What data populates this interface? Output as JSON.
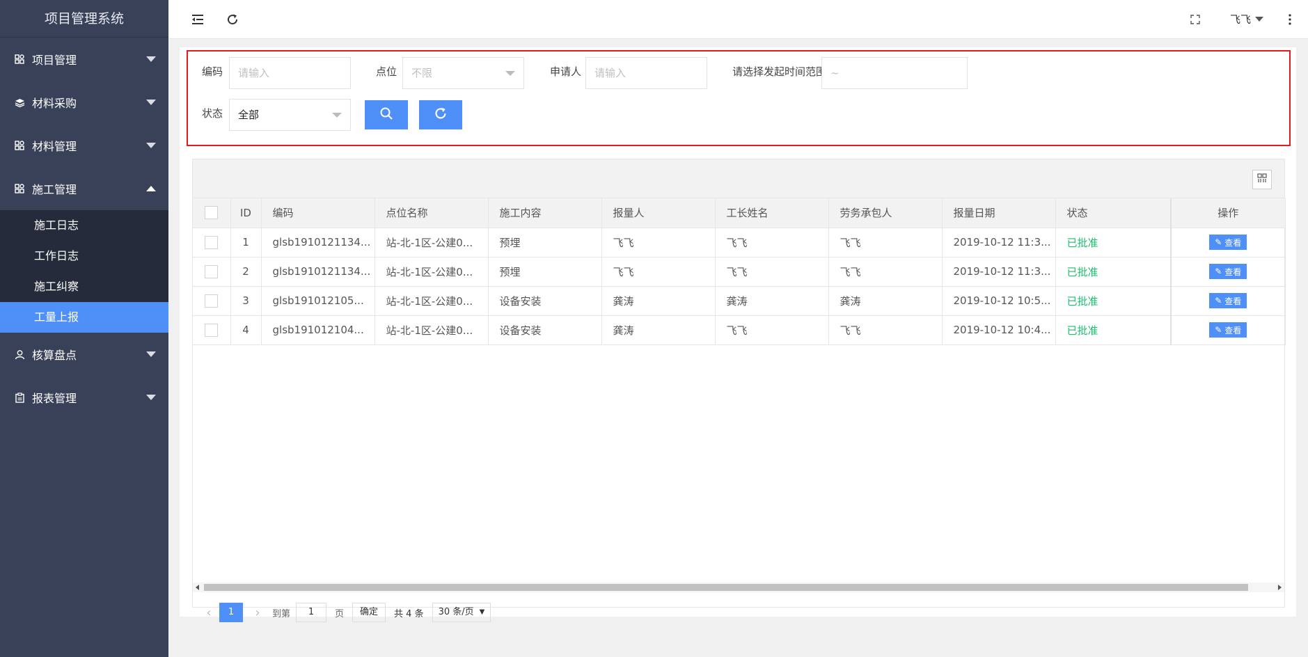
{
  "app": {
    "title": "项目管理系统"
  },
  "sidebar": {
    "items": [
      {
        "label": "项目管理",
        "icon": "grid-icon"
      },
      {
        "label": "材料采购",
        "icon": "layers-icon"
      },
      {
        "label": "材料管理",
        "icon": "grid-icon"
      },
      {
        "label": "施工管理",
        "icon": "grid-icon"
      },
      {
        "label": "核算盘点",
        "icon": "user-icon"
      },
      {
        "label": "报表管理",
        "icon": "clipboard-icon"
      }
    ],
    "sub_items": [
      {
        "label": "施工日志"
      },
      {
        "label": "工作日志"
      },
      {
        "label": "施工纠察"
      },
      {
        "label": "工量上报"
      }
    ]
  },
  "header": {
    "user": "飞飞"
  },
  "filter": {
    "code_label": "编码",
    "code_placeholder": "请输入",
    "point_label": "点位",
    "point_value": "不限",
    "applicant_label": "申请人",
    "applicant_placeholder": "请输入",
    "time_label": "请选择发起时间范围",
    "time_value": "~",
    "status_label": "状态",
    "status_value": "全部"
  },
  "table": {
    "headers": [
      "ID",
      "编码",
      "点位名称",
      "施工内容",
      "报量人",
      "工长姓名",
      "劳务承包人",
      "报量日期",
      "状态",
      "操作"
    ],
    "view_label": "查看",
    "rows": [
      [
        "1",
        "glsb1910121134...",
        "站-北-1区-公建0...",
        "预埋",
        "飞飞",
        "飞飞",
        "飞飞",
        "2019-10-12 11:3...",
        "已批准"
      ],
      [
        "2",
        "glsb1910121134...",
        "站-北-1区-公建0...",
        "预埋",
        "飞飞",
        "飞飞",
        "飞飞",
        "2019-10-12 11:3...",
        "已批准"
      ],
      [
        "3",
        "glsb191012105...",
        "站-北-1区-公建0...",
        "设备安装",
        "龚涛",
        "龚涛",
        "龚涛",
        "2019-10-12 10:5...",
        "已批准"
      ],
      [
        "4",
        "glsb191012104...",
        "站-北-1区-公建0...",
        "设备安装",
        "龚涛",
        "飞飞",
        "飞飞",
        "2019-10-12 10:4...",
        "已批准"
      ]
    ]
  },
  "pager": {
    "current": "1",
    "goto_label": "到第",
    "goto_value": "1",
    "page_label": "页",
    "ok_label": "确定",
    "total": "共 4 条",
    "size": "30 条/页"
  },
  "colors": {
    "accent": "#4e8ff8",
    "sidebar": "#394158",
    "submenu": "#252b3b",
    "highlight": "#e41b1b",
    "status": "#19be6b"
  }
}
